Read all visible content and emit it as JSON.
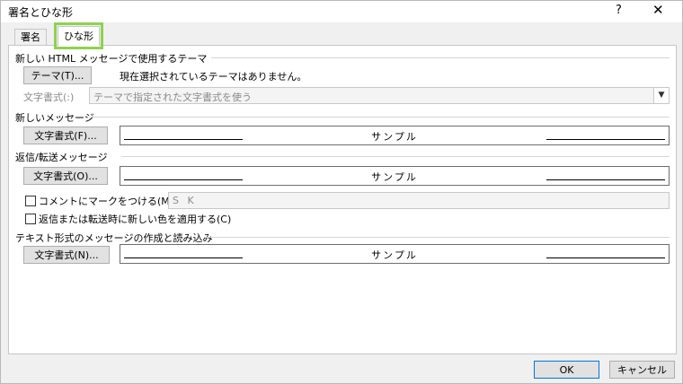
{
  "window": {
    "title": "署名とひな形",
    "help": "?",
    "close": "✕"
  },
  "tabs": [
    {
      "label": "署名"
    },
    {
      "label": "ひな形"
    }
  ],
  "theme_section": {
    "heading": "新しい HTML メッセージで使用するテーマ",
    "theme_button": "テーマ(T)...",
    "theme_status": "現在選択されているテーマはありません。",
    "font_label": "文字書式(:)",
    "font_select_value": "テーマで指定された文字書式を使う"
  },
  "new_mail": {
    "heading": "新しいメッセージ",
    "font_button": "文字書式(F)...",
    "sample": "サンプル"
  },
  "reply": {
    "heading": "返信/転送メッセージ",
    "font_button": "文字書式(O)...",
    "sample": "サンプル",
    "mark_comments_label": "コメントにマークをつける(M):",
    "initials_value": "S K",
    "new_color_label": "返信または転送時に新しい色を適用する(C)"
  },
  "plain_text": {
    "heading": "テキスト形式のメッセージの作成と読み込み",
    "font_button": "文字書式(N)...",
    "sample": "サンプル"
  },
  "footer": {
    "ok": "OK",
    "cancel": "キャンセル"
  }
}
